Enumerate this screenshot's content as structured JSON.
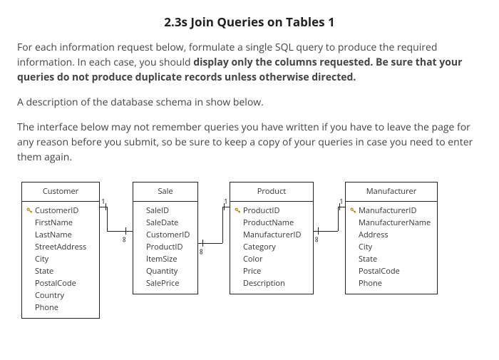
{
  "title": "2.3s Join Queries on Tables 1",
  "para1_plain": "For each information request below, formulate a single SQL query to produce the required information.  In each case, you should ",
  "para1_bold": "display only the columns requested.  Be sure that your queries do not produce duplicate records unless otherwise directed.",
  "para2": "A description of the database schema in show below.",
  "para3": "The interface below may not remember queries you have written if you have to leave the page for any reason before you submit, so be sure to keep a copy of your queries in case you need to enter them again.",
  "entities": {
    "customer": {
      "name": "Customer",
      "fields": [
        "CustomerID",
        "FirstName",
        "LastName",
        "StreetAddress",
        "City",
        "State",
        "PostalCode",
        "Country",
        "Phone"
      ],
      "pk": [
        true,
        false,
        false,
        false,
        false,
        false,
        false,
        false,
        false
      ]
    },
    "sale": {
      "name": "Sale",
      "fields": [
        "SaleID",
        "SaleDate",
        "CustomerID",
        "ProductID",
        "ItemSize",
        "Quantity",
        "SalePrice"
      ],
      "pk": [
        false,
        false,
        false,
        false,
        false,
        false,
        false
      ]
    },
    "product": {
      "name": "Product",
      "fields": [
        "ProductID",
        "ProductName",
        "ManufacturerID",
        "Category",
        "Color",
        "Price",
        "Description"
      ],
      "pk": [
        true,
        false,
        false,
        false,
        false,
        false,
        false
      ]
    },
    "manufacturer": {
      "name": "Manufacturer",
      "fields": [
        "ManufacturerID",
        "ManufacturerName",
        "Address",
        "City",
        "State",
        "PostalCode",
        "Phone"
      ],
      "pk": [
        true,
        false,
        false,
        false,
        false,
        false,
        false
      ]
    }
  },
  "cardinality": {
    "one": "1",
    "many": "∞"
  }
}
